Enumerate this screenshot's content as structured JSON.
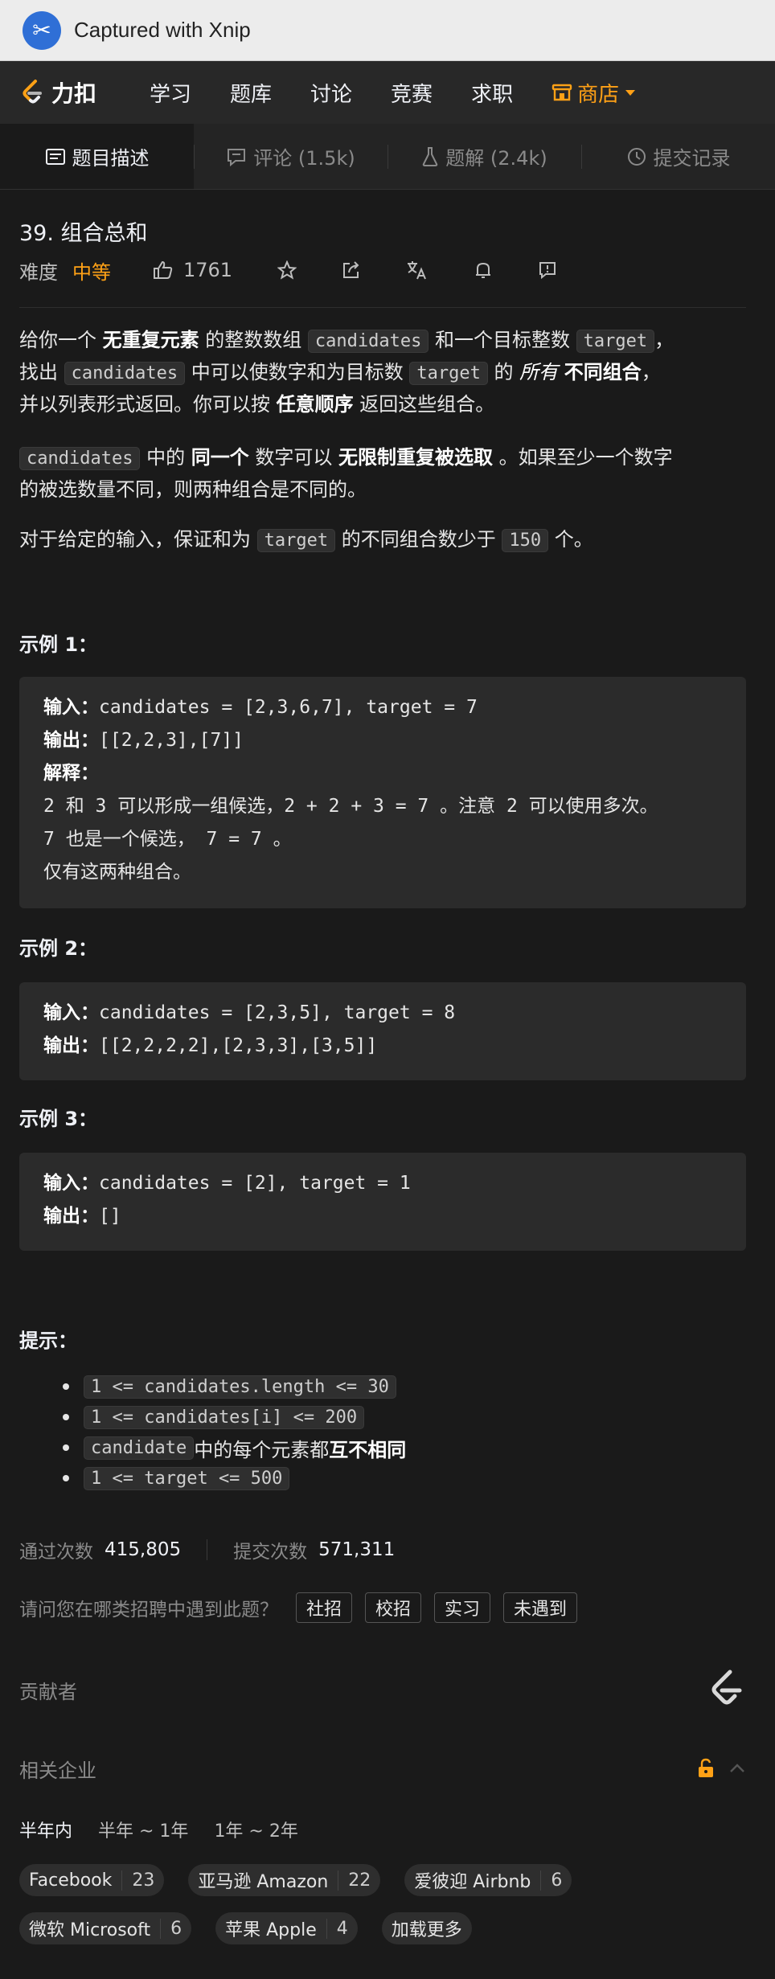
{
  "capture": {
    "title": "Captured with Xnip"
  },
  "nav": {
    "brand": "力扣",
    "items": [
      "学习",
      "题库",
      "讨论",
      "竞赛",
      "求职"
    ],
    "shop": "商店",
    "accent": "#ffa116"
  },
  "tabs": [
    {
      "label": "题目描述",
      "icon": "description-icon"
    },
    {
      "label": "评论 (1.5k)",
      "icon": "comment-icon"
    },
    {
      "label": "题解 (2.4k)",
      "icon": "flask-icon"
    },
    {
      "label": "提交记录",
      "icon": "clock-icon"
    }
  ],
  "problem": {
    "title": "39. 组合总和",
    "difficulty_label": "难度",
    "difficulty": "中等",
    "likes": "1761"
  },
  "description": {
    "p1": [
      "给你一个 ",
      "无重复元素",
      " 的整数数组 ",
      "candidates",
      " 和一个目标整数 ",
      "target",
      "，",
      "找出 ",
      "candidates",
      " 中可以使数字和为目标数 ",
      "target",
      " 的 ",
      "所有",
      " ",
      "不同组合",
      "，",
      "并以列表形式返回。你可以按 ",
      "任意顺序",
      " 返回这些组合。"
    ],
    "p2": [
      "candidates",
      " 中的 ",
      "同一个",
      " 数字可以 ",
      "无限制重复被选取",
      " 。如果至少一个数字",
      "的被选数量不同，则两种组合是不同的。"
    ],
    "p3": [
      "对于给定的输入，保证和为 ",
      "target",
      " 的不同组合数少于 ",
      "150",
      " 个。"
    ]
  },
  "examples": [
    {
      "title": "示例 1：",
      "input_label": "输入：",
      "input": "candidates = [2,3,6,7], target = 7",
      "output_label": "输出：",
      "output": "[[2,2,3],[7]]",
      "explain_label": "解释：",
      "explain": [
        "2 和 3 可以形成一组候选，2 + 2 + 3 = 7 。注意 2 可以使用多次。",
        "7 也是一个候选， 7 = 7 。",
        "仅有这两种组合。"
      ]
    },
    {
      "title": "示例 2：",
      "input_label": "输入：",
      "input": "candidates = [2,3,5], target = 8",
      "output_label": "输出：",
      "output": "[[2,2,2,2],[2,3,3],[3,5]]"
    },
    {
      "title": "示例 3：",
      "input_label": "输入：",
      "input": "candidates = [2], target = 1",
      "output_label": "输出：",
      "output": "[]"
    }
  ],
  "hints": {
    "title": "提示：",
    "items": [
      {
        "code": "1 <= candidates.length <= 30"
      },
      {
        "code": "1 <= candidates[i] <= 200"
      },
      {
        "code": "candidate",
        "text": " 中的每个元素都 ",
        "bold": "互不相同"
      },
      {
        "code": "1 <= target <= 500"
      }
    ]
  },
  "stats": {
    "pass_label": "通过次数",
    "pass": "415,805",
    "submit_label": "提交次数",
    "submit": "571,311"
  },
  "recruit": {
    "question": "请问您在哪类招聘中遇到此题？",
    "options": [
      "社招",
      "校招",
      "实习",
      "未遇到"
    ]
  },
  "contributors": {
    "label": "贡献者"
  },
  "companies": {
    "label": "相关企业",
    "periods": [
      "半年内",
      "半年 ~ 1年",
      "1年 ~ 2年"
    ],
    "tags": [
      {
        "name": "Facebook",
        "count": "23"
      },
      {
        "name": "亚马逊 Amazon",
        "count": "22"
      },
      {
        "name": "爱彼迎 Airbnb",
        "count": "6"
      },
      {
        "name": "微软 Microsoft",
        "count": "6"
      },
      {
        "name": "苹果 Apple",
        "count": "4"
      }
    ],
    "more": "加载更多"
  }
}
